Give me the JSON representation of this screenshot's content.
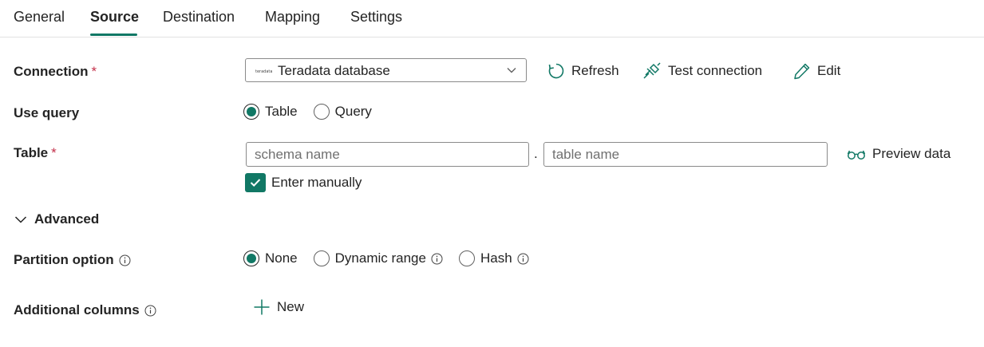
{
  "tabs": [
    {
      "label": "General"
    },
    {
      "label": "Source"
    },
    {
      "label": "Destination"
    },
    {
      "label": "Mapping"
    },
    {
      "label": "Settings"
    }
  ],
  "active_tab": "Source",
  "connection": {
    "label": "Connection",
    "required_mark": "*",
    "logo_text": "teradata",
    "selected_value": "Teradata database",
    "actions": {
      "refresh": "Refresh",
      "test": "Test connection",
      "edit": "Edit"
    }
  },
  "use_query": {
    "label": "Use query",
    "options": [
      "Table",
      "Query"
    ],
    "selected": "Table"
  },
  "table": {
    "label": "Table",
    "required_mark": "*",
    "schema_placeholder": "schema name",
    "table_placeholder": "table name",
    "separator": ".",
    "preview_label": "Preview data",
    "enter_manually_label": "Enter manually",
    "enter_manually_checked": true
  },
  "advanced": {
    "label": "Advanced",
    "expanded": true
  },
  "partition": {
    "label": "Partition option",
    "options": [
      "None",
      "Dynamic range",
      "Hash"
    ],
    "selected": "None"
  },
  "additional_columns": {
    "label": "Additional columns",
    "new_label": "New"
  },
  "colors": {
    "accent": "#117865",
    "required": "#c4314b",
    "text": "#242424",
    "border": "#8a8a8a"
  },
  "icons": {
    "refresh": "refresh-icon",
    "test_connection": "plug-connection-icon",
    "edit": "pencil-icon",
    "preview": "glasses-icon",
    "info": "info-icon",
    "advanced": "chevron-down-icon",
    "new": "plus-icon"
  }
}
